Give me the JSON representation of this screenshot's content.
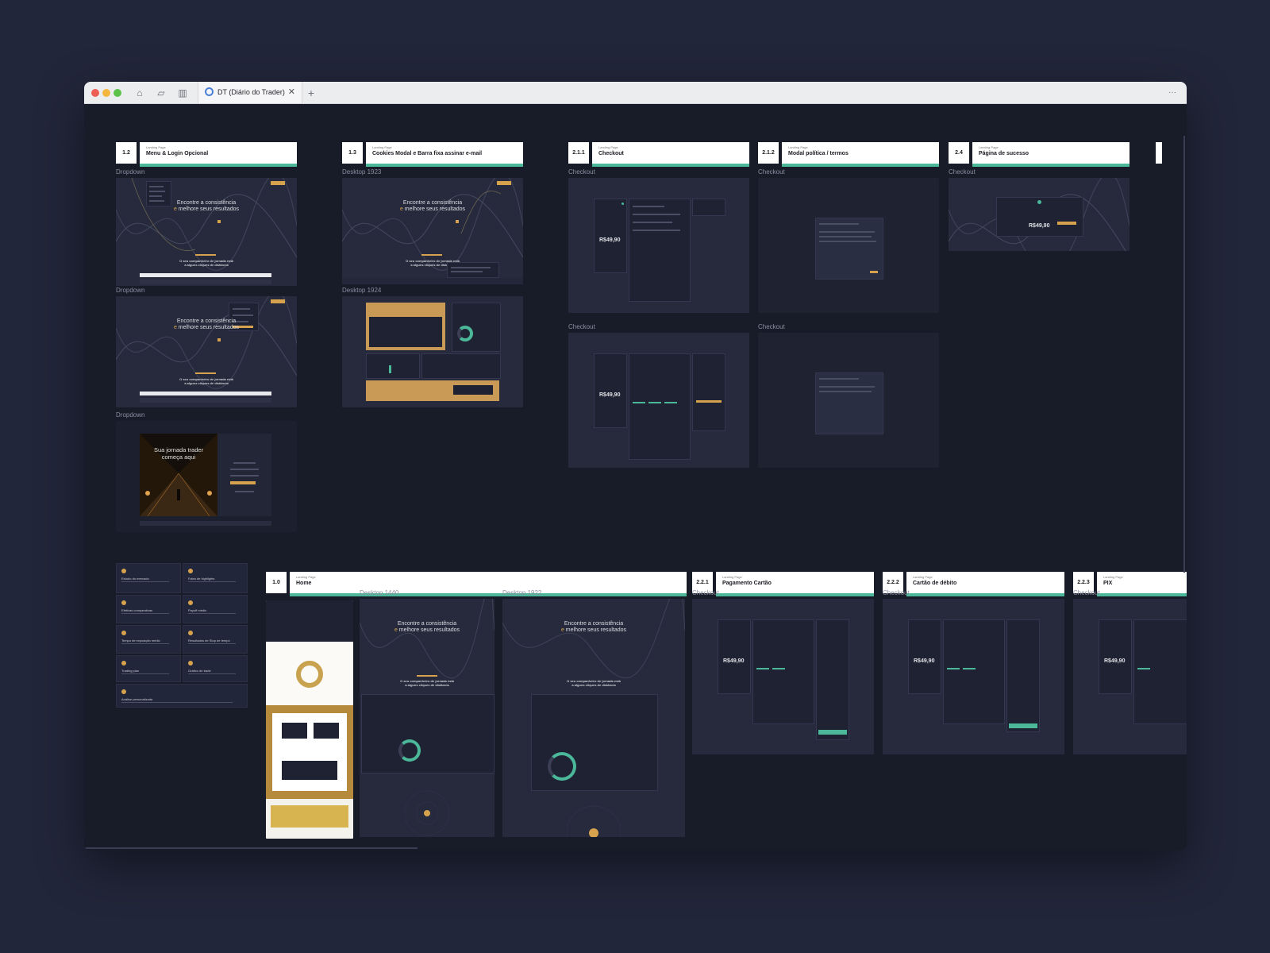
{
  "window": {
    "tab_title": "DT (Diário do Trader)",
    "toolbar_icons": [
      "home-icon",
      "sticky-note-icon",
      "book-icon"
    ],
    "new_tab_symbol": "+",
    "more_symbol": "···"
  },
  "sections": {
    "s1_2": {
      "num": "1.2",
      "sub": "Landing Page",
      "title": "Menu & Login Opcional"
    },
    "s1_3": {
      "num": "1.3",
      "sub": "Landing Page",
      "title": "Cookies Modal e Barra fixa assinar e-mail"
    },
    "s2_1_1": {
      "num": "2.1.1",
      "sub": "Landing Page",
      "title": "Checkout"
    },
    "s2_1_2": {
      "num": "2.1.2",
      "sub": "Landing Page",
      "title": "Modal política / termos"
    },
    "s2_4": {
      "num": "2.4",
      "sub": "Landing Page",
      "title": "Página de sucesso"
    },
    "s1_0": {
      "num": "1.0",
      "sub": "Landing Page",
      "title": "Home"
    },
    "s2_2_1": {
      "num": "2.2.1",
      "sub": "Landing Page",
      "title": "Pagamento Cartão"
    },
    "s2_2_2": {
      "num": "2.2.2",
      "sub": "Landing Page",
      "title": "Cartão de débito"
    },
    "s2_2_3": {
      "num": "2.2.3",
      "sub": "Landing Page",
      "title": "PIX"
    }
  },
  "frame_labels": {
    "dropdown": "Dropdown",
    "desktop_1923": "Desktop 1923",
    "desktop_1924": "Desktop 1924",
    "checkout": "Checkout",
    "desktop_1440": "Desktop 1440",
    "desktop_1922": "Desktop 1922"
  },
  "hero": {
    "line1": "Encontre a consistência",
    "line2_gold": "e",
    "line2_rest": "melhore seus resultados",
    "companion_1": "O seu companheiro de jornada está",
    "companion_2": "a alguns cliques de distância"
  },
  "login_hero": {
    "line1": "Sua jornada trader",
    "line2": "começa aqui"
  },
  "checkout": {
    "price": "R$49,90"
  },
  "features": [
    "Estudo do mercado",
    "Faixa de highlights",
    "Efetivas comparativas",
    "Payoff médio",
    "Tempo de exposição médio",
    "Resultados de Stop de tempo",
    "Trading plan",
    "Gráfico de trade",
    "Análise personalizada"
  ],
  "colors": {
    "accent_gold": "#d6a24e",
    "accent_green": "#4bb89a",
    "canvas": "#181b28"
  }
}
